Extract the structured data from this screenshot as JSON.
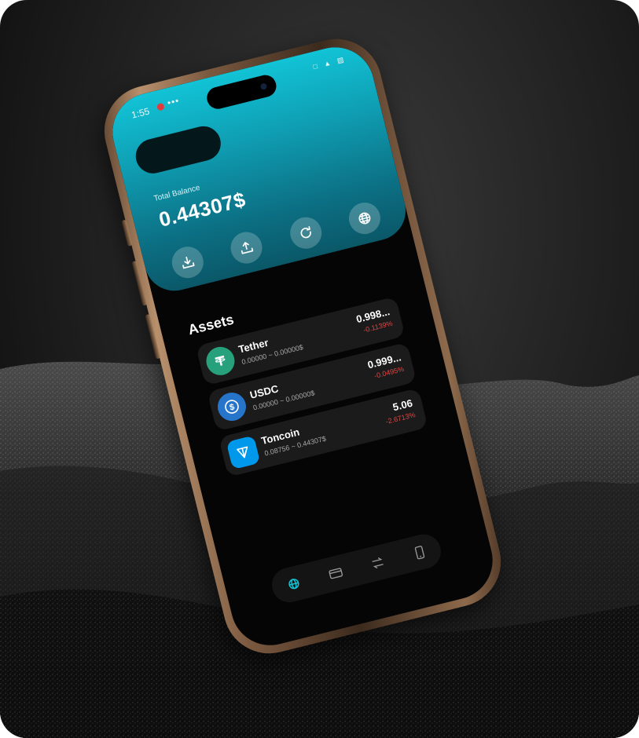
{
  "status_bar": {
    "time": "1:55",
    "more": "•••",
    "indicators": "□ ▲ ▨"
  },
  "wallet": {
    "balance_label": "Total Balance",
    "balance_value": "0.44307$",
    "accent_color": "#12c3d6"
  },
  "actions": [
    {
      "name": "receive-button",
      "icon": "download-tray-icon"
    },
    {
      "name": "send-button",
      "icon": "upload-tray-icon"
    },
    {
      "name": "refresh-button",
      "icon": "refresh-icon"
    },
    {
      "name": "network-button",
      "icon": "globe-icon"
    }
  ],
  "assets": {
    "title": "Assets",
    "items": [
      {
        "name": "Tether",
        "range": "0.00000 ~ 0.00000$",
        "price": "0.998...",
        "change": "-0.1139%",
        "logo_color": "#26a17b",
        "icon": "tether-icon"
      },
      {
        "name": "USDC",
        "range": "0.00000 ~ 0.00000$",
        "price": "0.999...",
        "change": "-0.0495%",
        "logo_color": "#2775ca",
        "icon": "usdc-icon"
      },
      {
        "name": "Toncoin",
        "range": "0.08756 ~ 0.44307$",
        "price": "5.06",
        "change": "-2.6713%",
        "logo_color": "#0098ea",
        "icon": "toncoin-icon"
      }
    ],
    "negative_color": "#e04545"
  },
  "dock": [
    {
      "name": "dock-wallet",
      "icon": "wallet-globe-icon",
      "active": true
    },
    {
      "name": "dock-cards",
      "icon": "card-icon"
    },
    {
      "name": "dock-swap",
      "icon": "swap-icon"
    },
    {
      "name": "dock-phone",
      "icon": "phone-icon"
    }
  ]
}
